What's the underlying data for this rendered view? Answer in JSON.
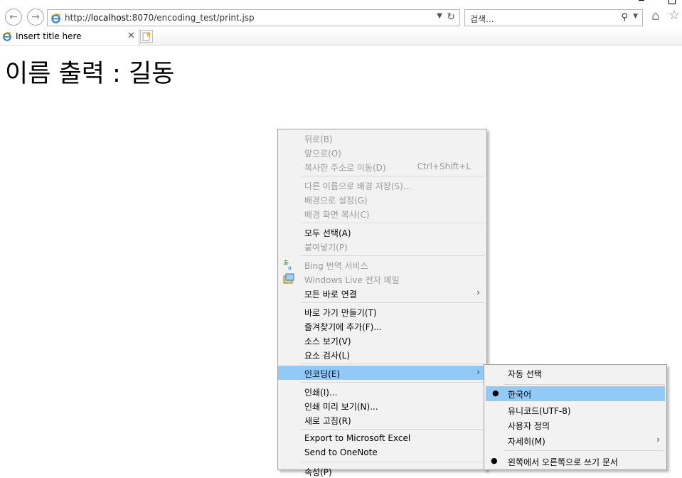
{
  "browser": {
    "url_prefix": "http://",
    "url_host": "localhost",
    "url_rest": ":8070/encoding_test/print.jsp",
    "search_placeholder": "검색...",
    "tab_title": "Insert title here"
  },
  "page": {
    "heading": "이름 출력 : 길동"
  },
  "context_menu": {
    "items": [
      {
        "label": "뒤로(B)",
        "enabled": false
      },
      {
        "label": "앞으로(O)",
        "enabled": false
      },
      {
        "label": "복사한 주소로 이동(D)",
        "enabled": false,
        "shortcut": "Ctrl+Shift+L"
      },
      {
        "label": "다른 이름으로 배경 저장(S)...",
        "enabled": false
      },
      {
        "label": "배경으로 설정(G)",
        "enabled": false
      },
      {
        "label": "배경 화면 복사(C)",
        "enabled": false
      },
      {
        "label": "모두 선택(A)",
        "enabled": true
      },
      {
        "label": "붙여넣기(P)",
        "enabled": false
      },
      {
        "label": "Bing 번역 서비스",
        "enabled": false,
        "icon": "translate-icon"
      },
      {
        "label": "Windows Live 전자 메일",
        "enabled": false,
        "icon": "mail-icon"
      },
      {
        "label": "모든 바로 연결",
        "enabled": true,
        "submenu": true
      },
      {
        "label": "바로 가기 만들기(T)",
        "enabled": true
      },
      {
        "label": "즐겨찾기에 추가(F)...",
        "enabled": true
      },
      {
        "label": "소스 보기(V)",
        "enabled": true
      },
      {
        "label": "요소 검사(L)",
        "enabled": true
      },
      {
        "label": "인코딩(E)",
        "enabled": true,
        "submenu": true,
        "highlighted": true
      },
      {
        "label": "인쇄(I)...",
        "enabled": true
      },
      {
        "label": "인쇄 미리 보기(N)...",
        "enabled": true
      },
      {
        "label": "새로 고침(R)",
        "enabled": true
      },
      {
        "label": "Export to Microsoft Excel",
        "enabled": true
      },
      {
        "label": "Send to OneNote",
        "enabled": true
      },
      {
        "label": "속성(P)",
        "enabled": true
      }
    ]
  },
  "encoding_submenu": {
    "items": [
      {
        "label": "자동 선택"
      },
      {
        "label": "한국어",
        "checked": true,
        "highlighted": true
      },
      {
        "label": "유니코드(UTF-8)"
      },
      {
        "label": "사용자 정의"
      },
      {
        "label": "자세히(M)",
        "submenu": true
      },
      {
        "label": "왼쪽에서 오른쪽으로 쓰기 문서",
        "checked": true
      }
    ]
  },
  "colors": {
    "highlight": "#91c9f7",
    "menu_bg": "#f2f2f2",
    "disabled_text": "#9a9a9a"
  }
}
